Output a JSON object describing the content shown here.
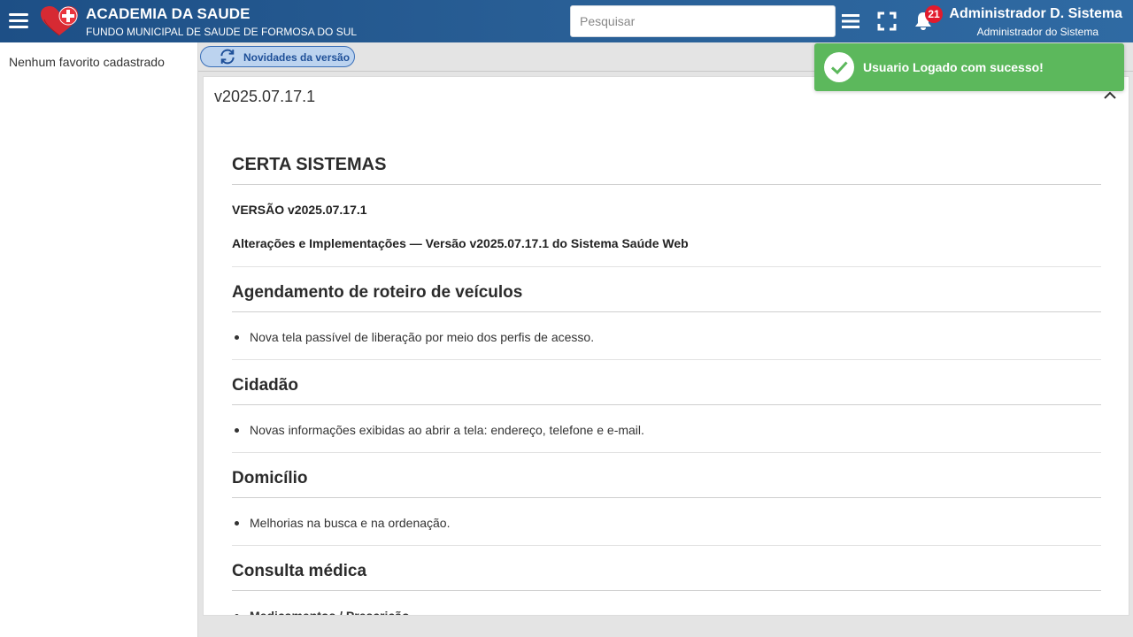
{
  "header": {
    "app_title": "ACADEMIA DA SAUDE",
    "app_subtitle": "FUNDO MUNICIPAL DE SAUDE DE FORMOSA DO SUL",
    "search_placeholder": "Pesquisar",
    "notifications_count": "21",
    "user_name": "Administrador D. Sistema",
    "user_role": "Administrador do Sistema",
    "icons": [
      "menu-icon",
      "heart-cross-logo",
      "list-icon",
      "fullscreen-icon",
      "bell-icon"
    ]
  },
  "sidebar": {
    "empty_favorites": "Nenhum favorito cadastrado"
  },
  "toolbar": {
    "news_label": "Novidades da versão"
  },
  "panel": {
    "version_title": "v2025.07.17.1",
    "company": "CERTA SISTEMAS",
    "version_line": "VERSÃO v2025.07.17.1",
    "changes_line": "Alterações e Implementações — Versão v2025.07.17.1 do Sistema Saúde Web",
    "sections": [
      {
        "title": "Agendamento de roteiro de veículos",
        "items": [
          "Nova tela passível de liberação por meio dos perfis de acesso."
        ]
      },
      {
        "title": "Cidadão",
        "items": [
          "Novas informações exibidas ao abrir a tela: endereço, telefone e e-mail."
        ]
      },
      {
        "title": "Domicílio",
        "items": [
          "Melhorias na busca e na ordenação."
        ]
      },
      {
        "title": "Consulta médica",
        "items": [
          "Medicamentos / Prescrição"
        ]
      }
    ]
  },
  "toast": {
    "message": "Usuario Logado com sucesso!"
  },
  "colors": {
    "header": "#295f96",
    "toast": "#5cb85c",
    "badge": "#e21b2c",
    "news_button": "#bcd3ef"
  }
}
